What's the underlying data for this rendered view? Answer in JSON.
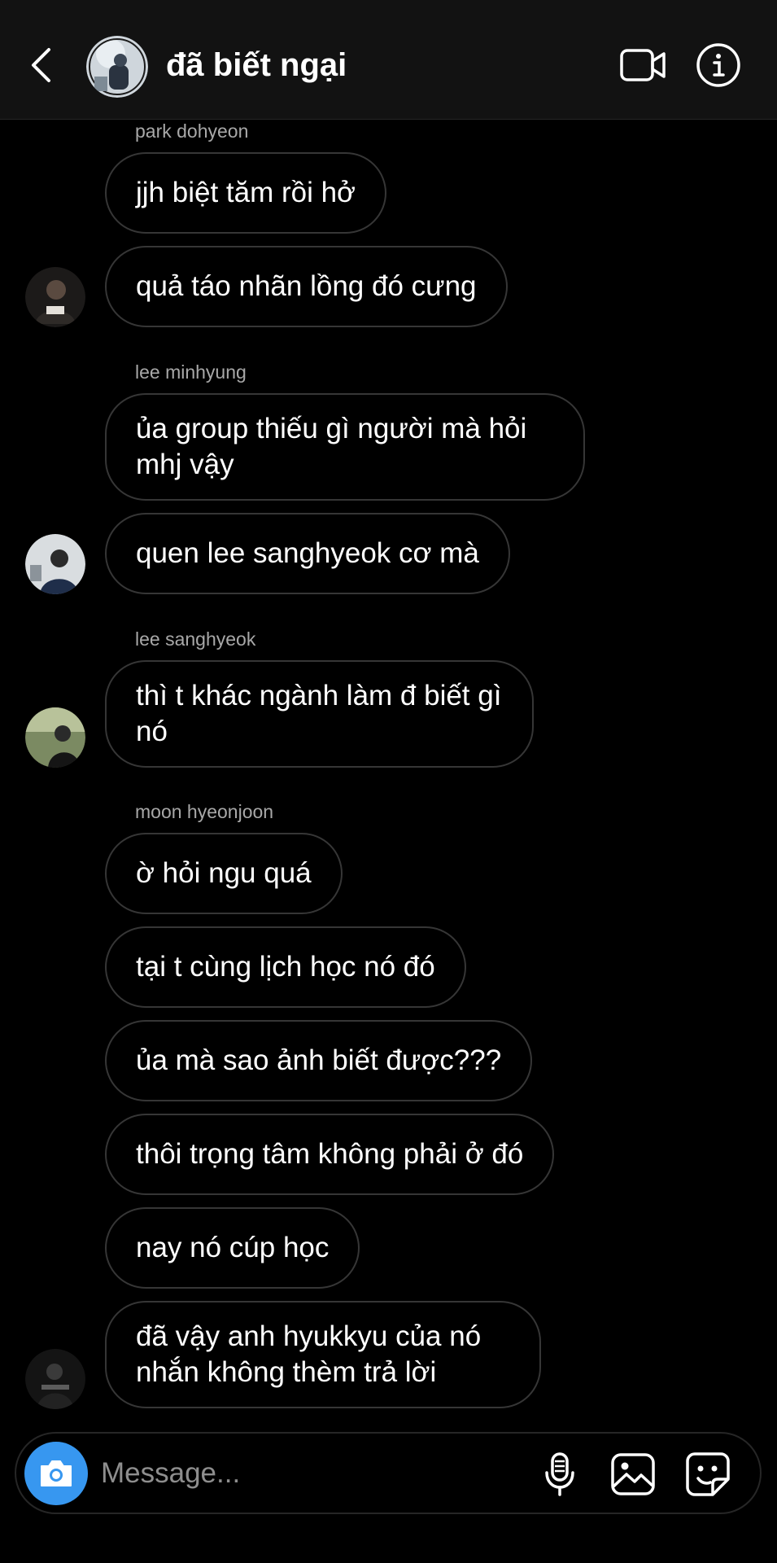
{
  "header": {
    "title": "đã biết ngại",
    "back_icon": "chevron-left-icon",
    "video_icon": "video-camera-icon",
    "info_icon": "info-icon"
  },
  "messages": [
    {
      "sender": "park dohyeon",
      "text": "jjh biệt tăm rồi hở"
    },
    {
      "text": "quả táo nhãn lồng đó cưng"
    },
    {
      "sender": "lee minhyung",
      "text": "ủa group thiếu gì người mà hỏi mhj vậy"
    },
    {
      "text": "quen lee sanghyeok cơ mà"
    },
    {
      "sender": "lee sanghyeok",
      "text": "thì t khác ngành làm đ biết gì nó"
    },
    {
      "sender": "moon hyeonjoon",
      "text": "ờ hỏi ngu quá"
    },
    {
      "text": "tại t cùng lịch học nó đó"
    },
    {
      "text": "ủa mà sao ảnh biết được???"
    },
    {
      "text": "thôi trọng tâm không phải ở đó"
    },
    {
      "text": "nay nó cúp học"
    },
    {
      "text": "đã vậy anh hyukkyu của nó nhắn không thèm trả lời"
    }
  ],
  "composer": {
    "placeholder": "Message...",
    "camera_icon": "camera-icon",
    "mic_icon": "microphone-icon",
    "gallery_icon": "gallery-icon",
    "sticker_icon": "sticker-icon"
  },
  "colors": {
    "background": "#000000",
    "header_bg": "#121212",
    "bubble_border": "#363636",
    "sender_text": "#a8a8a8",
    "accent": "#3797f0"
  }
}
